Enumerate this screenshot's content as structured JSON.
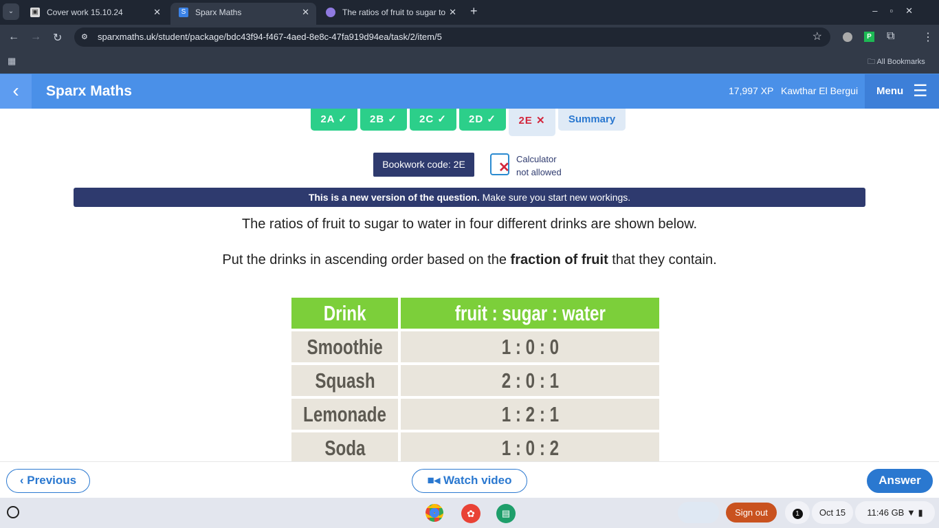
{
  "browser": {
    "tabs": [
      {
        "title": "Cover work 15.10.24"
      },
      {
        "title": "Sparx Maths",
        "active": true
      },
      {
        "title": "The ratios of fruit to sugar to w"
      }
    ],
    "url": "sparxmaths.uk/student/package/bdc43f94-f467-4aed-8e8c-47fa919d94ea/task/2/item/5",
    "bookmarks_label": "All Bookmarks"
  },
  "header": {
    "title": "Sparx Maths",
    "xp": "17,997 XP",
    "user": "Kawthar El Bergui",
    "menu": "Menu",
    "color": "#4a90e8"
  },
  "task_tabs": [
    {
      "label": "2A",
      "status": "correct"
    },
    {
      "label": "2B",
      "status": "correct"
    },
    {
      "label": "2C",
      "status": "correct"
    },
    {
      "label": "2D",
      "status": "correct"
    },
    {
      "label": "2E",
      "status": "incorrect"
    },
    {
      "label": "Summary"
    }
  ],
  "bookwork": "Bookwork code: 2E",
  "calculator": {
    "line1": "Calculator",
    "line2": "not allowed"
  },
  "banner": {
    "bold": "This is a new version of the question.",
    "rest": " Make sure you start new workings."
  },
  "question": {
    "line1": "The ratios of fruit to sugar to water in four different drinks are shown below.",
    "line2_pre": "Put the drinks in ascending order based on the ",
    "line2_bold": "fraction of fruit",
    "line2_post": " that they contain."
  },
  "table": {
    "headers": [
      "Drink",
      "fruit : sugar : water"
    ],
    "rows": [
      [
        "Smoothie",
        "1 : 0 : 0"
      ],
      [
        "Squash",
        "2 : 0 : 1"
      ],
      [
        "Lemonade",
        "1 : 2 : 1"
      ],
      [
        "Soda",
        "1 : 0 : 2"
      ]
    ]
  },
  "footer": {
    "previous": "Previous",
    "watch": "Watch video",
    "answer": "Answer"
  },
  "shelf": {
    "signout": "Sign out",
    "notif": "1",
    "date": "Oct 15",
    "time": "11:46",
    "locale": "GB"
  }
}
